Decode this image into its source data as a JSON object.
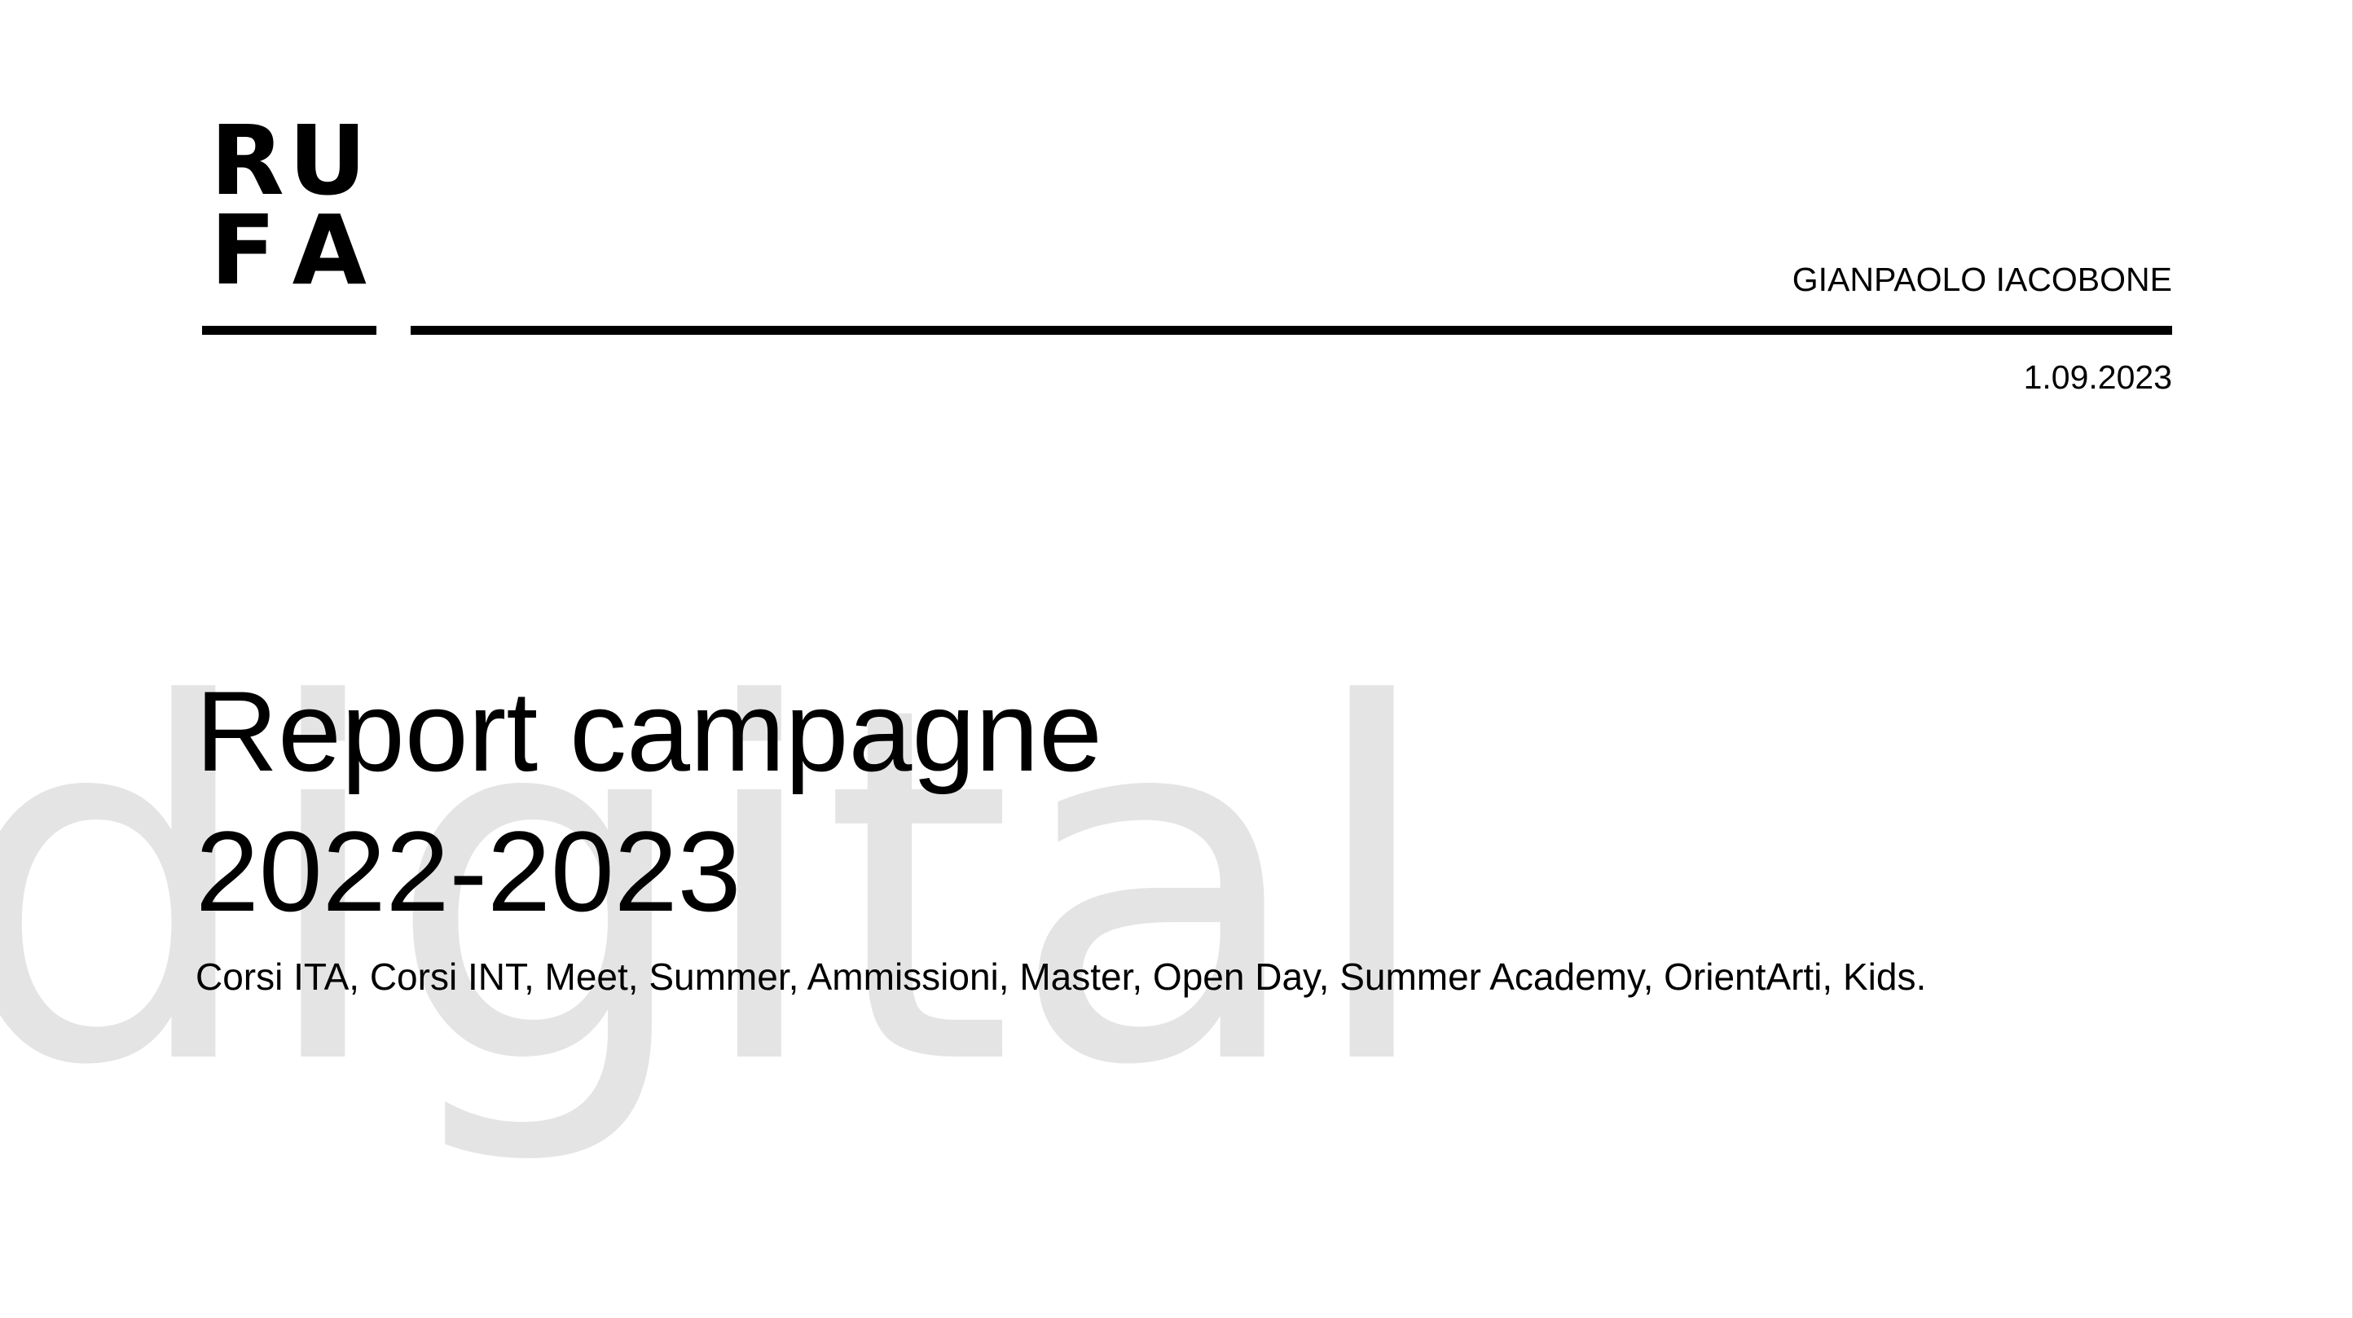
{
  "logo": {
    "row1": [
      "R",
      "U"
    ],
    "row2": [
      "F",
      "A"
    ]
  },
  "header": {
    "author": "GIANPAOLO IACOBONE",
    "date": "1.09.2023"
  },
  "main": {
    "title_line1": "Report campagne",
    "title_line2": "2022-2023",
    "subtitle": "Corsi ITA, Corsi INT, Meet, Summer, Ammissioni, Master, Open Day, Summer Academy, OrientArti, Kids."
  },
  "watermark": {
    "text": "digital",
    "color": "#e4e4e4"
  },
  "colors": {
    "background": "#ffffff",
    "text": "#000000",
    "rule": "#000000"
  }
}
